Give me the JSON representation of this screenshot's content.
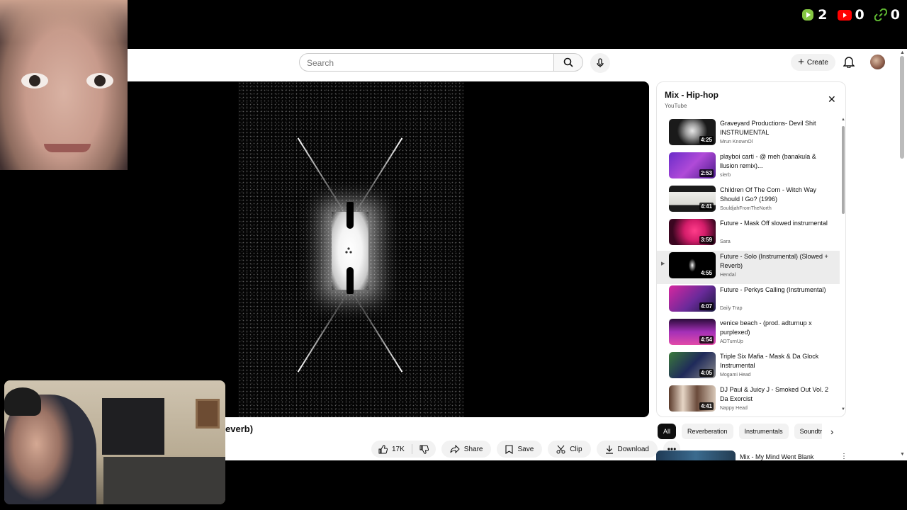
{
  "stream_stats": {
    "rumble_count": "2",
    "youtube_count": "0",
    "links_count": "0"
  },
  "youtube": {
    "search_placeholder": "Search",
    "create_label": "Create",
    "video_title_fragment": "everb)",
    "actions": {
      "likes": "17K",
      "share": "Share",
      "save": "Save",
      "clip": "Clip",
      "download": "Download"
    },
    "playlist": {
      "title": "Mix - Hip-hop",
      "subtitle": "YouTube",
      "items": [
        {
          "title": "Graveyard Productions- Devil Shit INSTRUMENTAL",
          "channel": "Mrun KnownOl",
          "duration": "4:25"
        },
        {
          "title": "playboi carti - @ meh (banakula & llusion remix)...",
          "channel": "slerb",
          "duration": "2:53"
        },
        {
          "title": "Children Of The Corn - Witch Way Should I Go? (1996)",
          "channel": "SouldjahFromTheNorth",
          "duration": "4:41"
        },
        {
          "title": "Future - Mask Off slowed instrumental",
          "channel": "Sara",
          "duration": "3:59"
        },
        {
          "title": "Future - Solo (Instrumental) (Slowed + Reverb)",
          "channel": "Hendal",
          "duration": "4:55"
        },
        {
          "title": "Future - Perkys Calling (Instrumental)",
          "channel": "Daily Trap",
          "duration": "4:07"
        },
        {
          "title": "venice beach - (prod. adturnup x purplexed)",
          "channel": "ADTurnUp",
          "duration": "4:54"
        },
        {
          "title": "Triple Six Mafia - Mask & Da Glock Instrumental",
          "channel": "Mogami Head",
          "duration": "4:05"
        },
        {
          "title": "DJ Paul & Juicy J - Smoked Out Vol. 2 Da Exorcist",
          "channel": "Nappy Head",
          "duration": "4:41"
        }
      ]
    },
    "chips": [
      "All",
      "Reverberation",
      "Instrumentals",
      "Soundtr"
    ],
    "next_mix_title": "Mix - My Mind Went Blank"
  },
  "colors": {
    "rumble_green": "#85c742",
    "youtube_red": "#ff0000",
    "link_green": "#5fb832"
  }
}
